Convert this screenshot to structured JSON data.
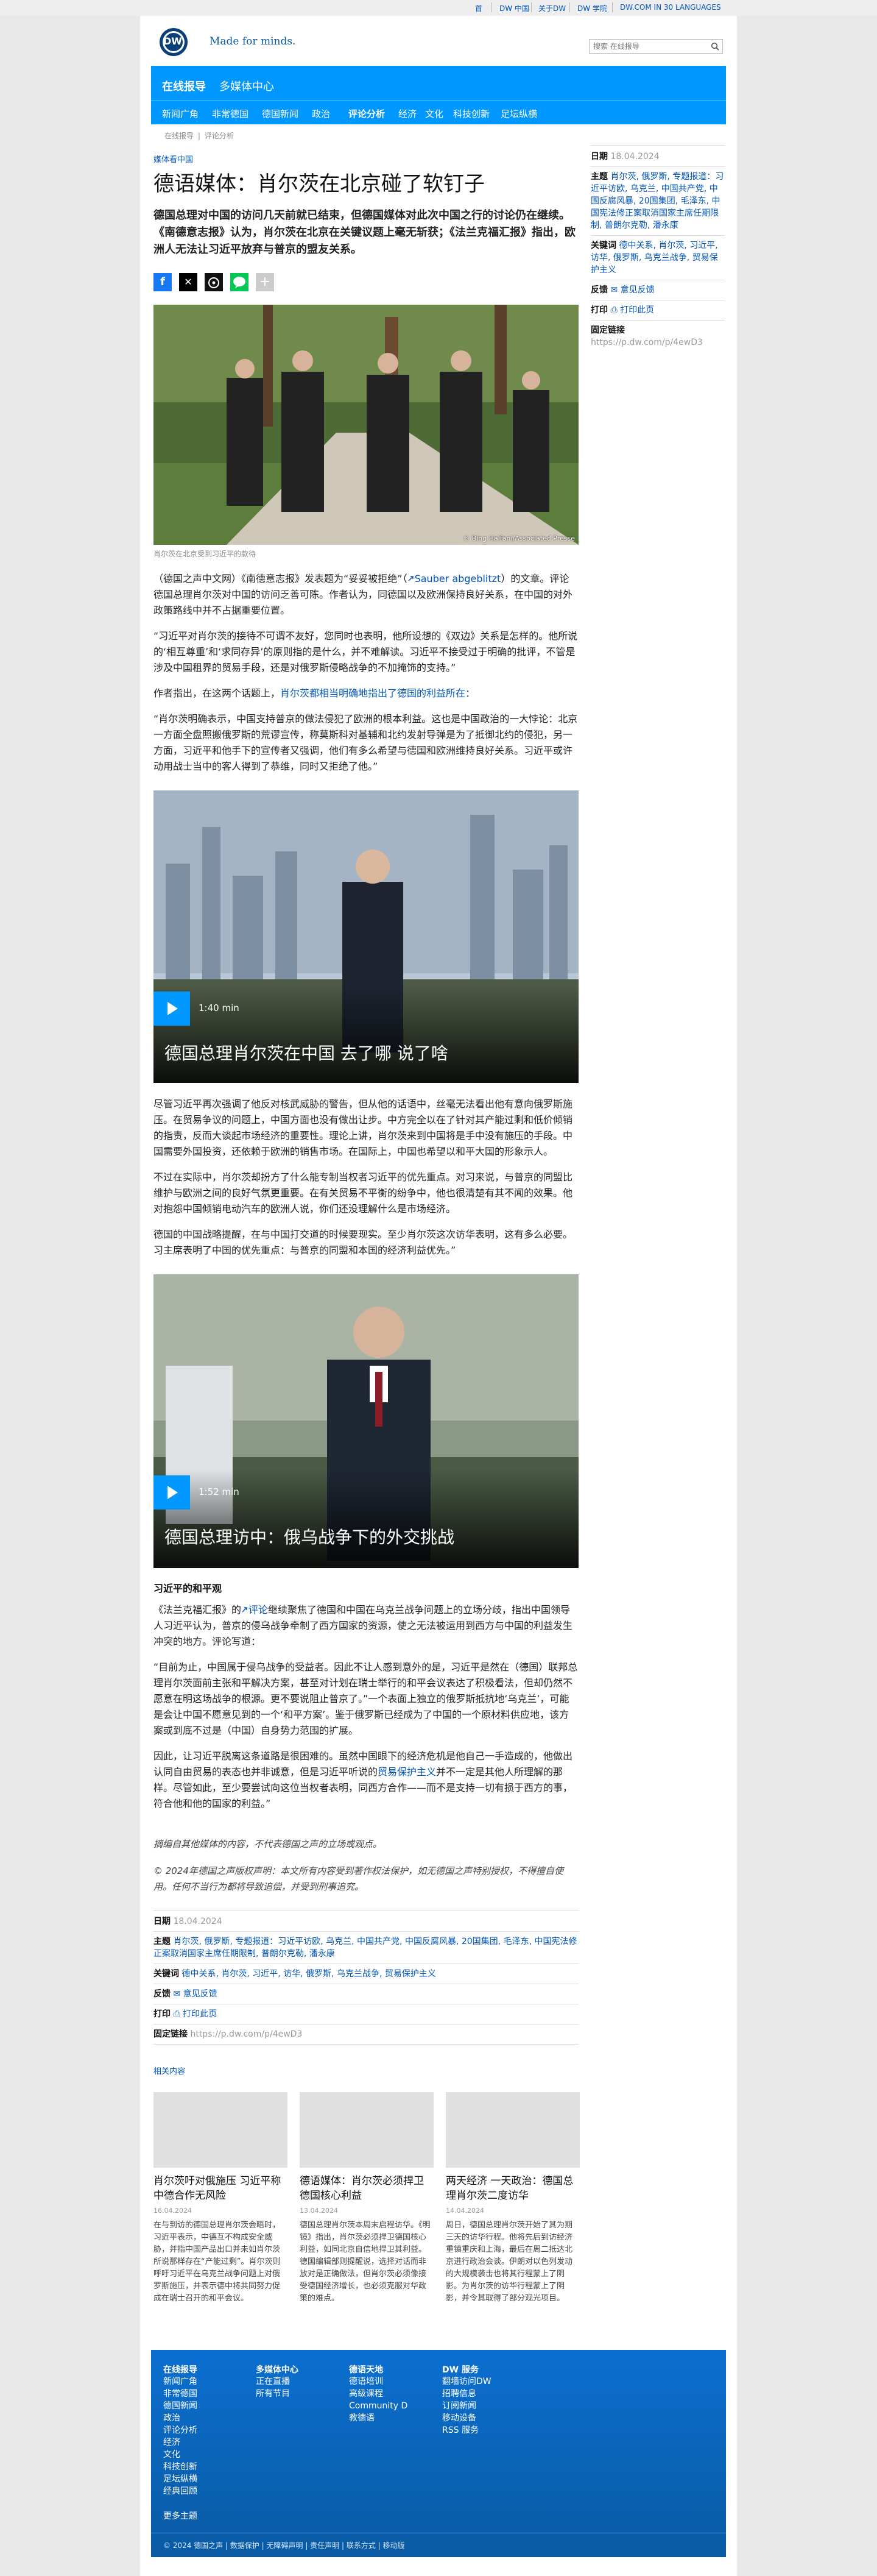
{
  "topbar": {
    "links": [
      "首",
      "DW 中国",
      "关于DW",
      "DW 学院",
      "DW.COM IN 30 LANGUAGES"
    ]
  },
  "header": {
    "logo_text": "DW",
    "slogan": "Made for minds.",
    "search_placeholder": "搜索 在线报导"
  },
  "nav": {
    "title": "在线报导",
    "media_center": "多媒体中心",
    "items": [
      "新闻广角",
      "非常德国",
      "德国新闻",
      "政治",
      "评论分析",
      "经济",
      "文化",
      "科技创新",
      "足坛纵横"
    ],
    "active_index": 4,
    "breadcrumb": [
      "在线报导",
      "评论分析"
    ]
  },
  "article": {
    "kicker": "媒体看中国",
    "title": "德语媒体：肖尔茨在北京碰了软钉子",
    "lead": "德国总理对中国的访问几天前就已结束，但德国媒体对此次中国之行的讨论仍在继续。《南德意志报》认为，肖尔茨在北京在关键议题上毫无斩获；《法兰克福汇报》指出，欧洲人无法让习近平放弃与普京的盟友关系。",
    "photo_credit": "© Bing Halfani/Associated Presse",
    "photo_caption": "肖尔茨在北京受到习近平的款待",
    "paragraphs": [
      "（德国之声中文网）《南德意志报》发表题为“妥妥被拒绝”（",
      "Sauber abgeblitzt",
      "）的文章。评论德国总理肖尔茨对中国的访问乏善可陈。作者认为，同德国以及欧洲保持良好关系，在中国的对外政策路线中并不占据重要位置。",
      "“习近平对肖尔茨的接待不可谓不友好，您同时也表明，他所设想的《双边》关系是怎样的。他所说的‘相互尊重’和‘求同存异’的原则指的是什么，并不难解读。习近平不接受过于明确的批评，不管是涉及中国租界的贸易手段，还是对俄罗斯侵略战争的不加掩饰的支持。”",
      "作者指出，在这两个话题上，",
      "肖尔茨都相当明确地指出了德国的利益所在：",
      "“肖尔茨明确表示，中国支持普京的做法侵犯了欧洲的根本利益。这也是中国政治的一大悖论：北京一方面全盘照搬俄罗斯的荒谬宣传，称莫斯科对基辅和北约发射导弹是为了抵御北约的侵犯，另一方面，习近平和他手下的宣传者又强调，他们有多么希望与德国和欧洲维持良好关系。习近平或许动用战士当中的客人得到了恭维，同时又拒绝了他。”"
    ],
    "video1": {
      "duration": "1:40 min",
      "title": "德国总理肖尔茨在中国 去了哪 说了啥"
    },
    "paragraphs2": [
      "尽管习近平再次强调了他反对核武威胁的警告，但从他的话语中，丝毫无法看出他有意向俄罗斯施压。在贸易争议的问题上，中国方面也没有做出让步。中方完全以在了针对其产能过剩和低价倾销的指责，反而大谈起市场经济的重要性。理论上讲，肖尔茨来到中国将是手中没有施压的手段。中国需要外国投资，还依赖于欧洲的销售市场。在国际上，中国也希望以和平大国的形象示人。",
      "不过在实际中，肖尔茨却扮方了什么能专制当权者习近平的优先重点。对习来说，与普京的同盟比维护与欧洲之间的良好气氛更重要。在有关贸易不平衡的纷争中，他也很清楚有其不闻的效果。他对抱怨中国倾销电动汽车的欧洲人说，你们还没理解什么是市场经济。",
      "德国的中国战略提醒，在与中国打交道的时候要现实。至少肖尔茨这次访华表明，这有多么必要。习主席表明了中国的优先重点：与普京的同盟和本国的经济利益优先。”"
    ],
    "video2": {
      "duration": "1:52 min",
      "title": "德国总理访中：俄乌战争下的外交挑战"
    },
    "subheading": "习近平的和平观",
    "paragraphs3": [
      "《法兰克福汇报》的",
      "评论",
      "继续聚焦了德国和中国在乌克兰战争问题上的立场分歧，指出中国领导人习近平认为，普京的侵乌战争牵制了西方国家的资源，使之无法被运用到西方与中国的利益发生冲突的地方。评论写道：",
      "“目前为止，中国属于侵乌战争的受益者。因此不让人感到意外的是，习近平是然在（德国）联邦总理肖尔茨面前主张和平解决方案，甚至对计划在瑞士举行的和平会议表达了积极看法，但却仍然不愿意在明这场战争的根源。更不要说阻止普京了。”一个表面上独立的俄罗斯抵抗地‘乌克兰’，可能是会让中国不愿意见到的一个‘和平方案’。鉴于俄罗斯已经成为了中国的一个原材料供应地，该方案或到底不过是（中国）自身势力范围的扩展。",
      "因此，让习近平脱离这条道路是很困难的。虽然中国眼下的经济危机是他自己一手造成的，他做出认同自由贸易的表态也并非诚意，但是习近平听说的",
      "贸易保护主义",
      "并不一定是其他人所理解的那样。尽管如此，至少要尝试向这位当权者表明，同西方合作——而不是支持一切有损于西方的事，符合他和他的国家的利益。”"
    ],
    "disclaimer": "摘编自其他媒体的内容，不代表德国之声的立场或观点。",
    "copyright": "© 2024年德国之声版权声明：本文所有内容受到著作权法保护，如无德国之声特别授权，不得擅自使用。任何不当行为都将导致追偿，并受到刑事追究。"
  },
  "meta": {
    "date_label": "日期",
    "date": "18.04.2024",
    "topics_label": "主题",
    "topics": "肖尔茨, 俄罗斯, 专题报道：习近平访欧, 乌克兰, 中国共产党, 中国反腐风暴, 20国集团, 毛泽东, 中国宪法修正案取消国家主席任期限制, 普朗尔克勒, 潘永康",
    "keywords_label": "关键词",
    "keywords": "德中关系, 肖尔茨, 习近平, 访华, 俄罗斯, 乌克兰战争, 贸易保护主义",
    "feedback_label": "反馈",
    "feedback": "意见反馈",
    "print_label": "打印",
    "print": "打印此页",
    "permalink_label": "固定链接",
    "permalink": "https://p.dw.com/p/4ewD3"
  },
  "related": {
    "heading": "相关内容",
    "items": [
      {
        "title": "肖尔茨吁对俄施压 习近平称中德合作无风险",
        "date": "16.04.2024",
        "excerpt": "在与到访的德国总理肖尔茨会晤时，习近平表示，中德互不构成安全威胁，并指中国产品出口并未如肖尔茨所说那样存在“产能过剩”。肖尔茨则呼吁习近平在乌克兰战争问题上对俄罗斯施压，并表示德中将共同努力促成在瑞士召开的和平会议。"
      },
      {
        "title": "德语媒体：肖尔茨必须捍卫德国核心利益",
        "date": "13.04.2024",
        "excerpt": "德国总理肖尔茨本周末启程访华。《明镜》指出，肖尔茨必须捍卫德国核心利益，如同北京自信地捍卫其利益。德国编辑部则提醒说，选择对话而非放对是正确做法，但肖尔茨必须像接受德国经济增长，也必须克服对华政策的难点。"
      },
      {
        "title": "两天经济 一天政治：德国总理肖尔茨二度访华",
        "date": "14.04.2024",
        "excerpt": "周日，德国总理肖尔茨开始了其为期三天的访华行程。他将先后到访经济重镇重庆和上海，最后在周二抵达北京进行政治会谈。伊朗对以色列发动的大规模袭击也将其行程蒙上了阴影。为肖尔茨的访华行程蒙上了阴影，并令其取得了部分观光项目。"
      }
    ]
  },
  "footer": {
    "columns": [
      {
        "heading": "在线报导",
        "links": [
          "新闻广角",
          "非常德国",
          "德国新闻",
          "政治",
          "评论分析",
          "经济",
          "文化",
          "科技创新",
          "足坛纵横",
          "经典回顾"
        ]
      },
      {
        "heading": "多媒体中心",
        "links": [
          "正在直播",
          "所有节目"
        ]
      },
      {
        "heading": "德语天地",
        "links": [
          "德语培训",
          "高级课程",
          "Community D",
          "教德语"
        ]
      },
      {
        "heading": "DW 服务",
        "links": [
          "翻墙访问DW",
          "招聘信息",
          "订阅新闻",
          "移动设备",
          "RSS 服务"
        ]
      }
    ],
    "extra_link": "更多主题",
    "bottom": "© 2024 德国之声 | 数据保护 | 无障碍声明 | 责任声明 | 联系方式 | 移动版"
  },
  "colors": {
    "brand": "#0a5aa3",
    "accent": "#0098ff",
    "link": "#0055bb"
  }
}
